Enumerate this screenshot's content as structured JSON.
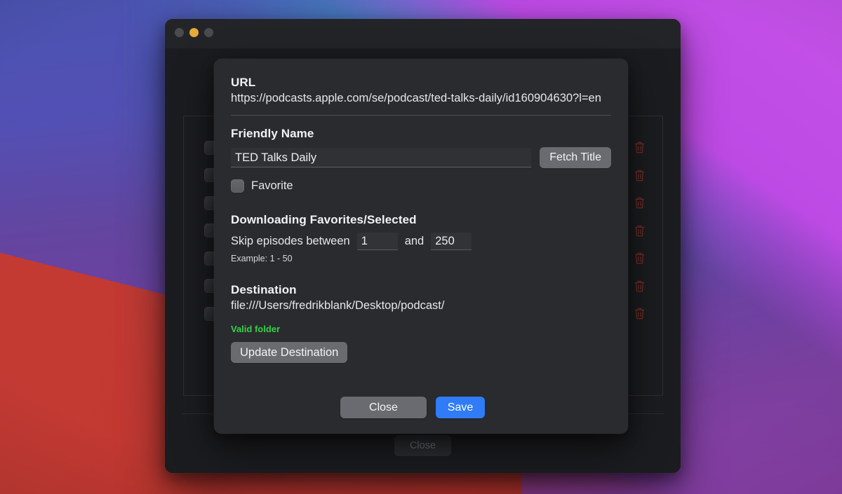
{
  "window": {
    "traffic_lights": [
      {
        "name": "close",
        "color": "#4a4b4f",
        "state": "inactive"
      },
      {
        "name": "minimize",
        "color": "#e9a93a",
        "state": "active"
      },
      {
        "name": "zoom",
        "color": "#4a4b4f",
        "state": "inactive"
      }
    ],
    "footer": {
      "close_label": "Close"
    },
    "list_rows": [
      {
        "checkbox": "unchecked",
        "delete_icon": "trash-icon"
      },
      {
        "checkbox": "unchecked",
        "delete_icon": "trash-icon"
      },
      {
        "checkbox": "unchecked",
        "delete_icon": "trash-icon"
      },
      {
        "checkbox": "unchecked",
        "delete_icon": "trash-icon"
      },
      {
        "checkbox": "unchecked",
        "delete_icon": "trash-icon"
      },
      {
        "checkbox": "unchecked",
        "delete_icon": "trash-icon"
      },
      {
        "checkbox": "unchecked",
        "delete_icon": "trash-icon"
      }
    ]
  },
  "dialog": {
    "url": {
      "label": "URL",
      "value": "https://podcasts.apple.com/se/podcast/ted-talks-daily/id160904630?l=en"
    },
    "friendly_name": {
      "label": "Friendly Name",
      "value": "TED Talks Daily",
      "placeholder": "",
      "fetch_title_label": "Fetch Title"
    },
    "favorite": {
      "label": "Favorite",
      "checked": false
    },
    "downloading": {
      "label": "Downloading Favorites/Selected",
      "skip_prefix": "Skip episodes between",
      "skip_from": "1",
      "skip_conjunction": "and",
      "skip_to": "250",
      "example": "Example: 1 - 50"
    },
    "destination": {
      "label": "Destination",
      "value": "file:///Users/fredrikblank/Desktop/podcast/",
      "status": "Valid folder",
      "status_color": "#36d04a",
      "update_label": "Update Destination"
    },
    "footer": {
      "close_label": "Close",
      "save_label": "Save",
      "save_color": "#2f7cf6"
    }
  }
}
